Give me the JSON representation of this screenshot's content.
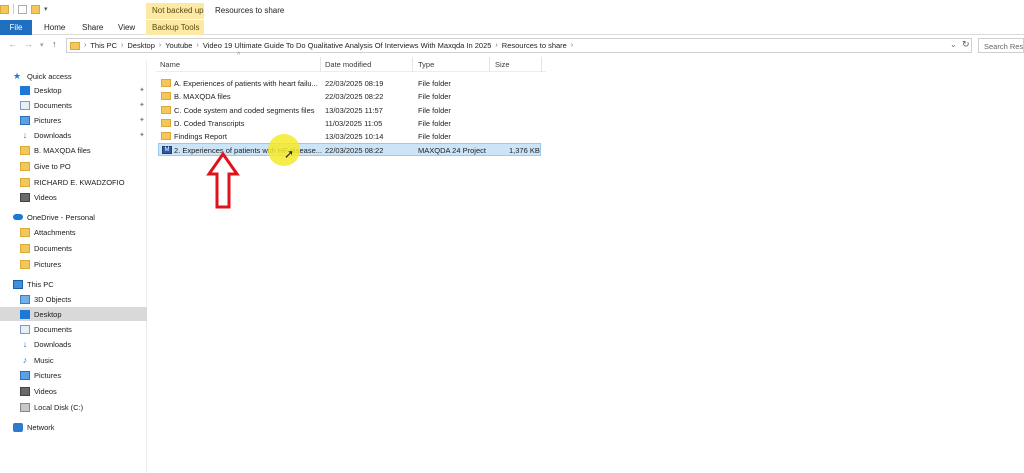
{
  "ribbon": {
    "manage_tab": "Not backed up",
    "window_title": "Resources to share",
    "tabs": {
      "file": "File",
      "home": "Home",
      "share": "Share",
      "view": "View",
      "backup_tools": "Backup Tools"
    }
  },
  "address_bar": {
    "crumbs": [
      "This PC",
      "Desktop",
      "Youtube",
      "Video 19 Ultimate Guide To Do Qualitative Analysis Of Interviews With Maxqda In 2025",
      "Resources to share"
    ]
  },
  "search": {
    "placeholder": "Search Reso"
  },
  "nav": {
    "quick_access": "Quick access",
    "qa_items": [
      "Desktop",
      "Documents",
      "Pictures",
      "Downloads",
      "B. MAXQDA files",
      "Give to PO",
      "RICHARD E. KWADZOFIO",
      "Videos"
    ],
    "onedrive": "OneDrive - Personal",
    "od_items": [
      "Attachments",
      "Documents",
      "Pictures"
    ],
    "this_pc": "This PC",
    "pc_items": [
      "3D Objects",
      "Desktop",
      "Documents",
      "Downloads",
      "Music",
      "Pictures",
      "Videos",
      "Local Disk (C:)"
    ],
    "network": "Network"
  },
  "columns": {
    "name": "Name",
    "date": "Date modified",
    "type": "Type",
    "size": "Size"
  },
  "files": [
    {
      "name": "A. Experiences of patients with heart failu...",
      "date": "22/03/2025 08:19",
      "type": "File folder",
      "size": ""
    },
    {
      "name": "B. MAXQDA files",
      "date": "22/03/2025 08:22",
      "type": "File folder",
      "size": ""
    },
    {
      "name": "C. Code system and coded segments files",
      "date": "13/03/2025 11:57",
      "type": "File folder",
      "size": ""
    },
    {
      "name": "D. Coded Transcripts",
      "date": "11/03/2025 11:05",
      "type": "File folder",
      "size": ""
    },
    {
      "name": "Findings Report",
      "date": "13/03/2025 10:14",
      "type": "File folder",
      "size": ""
    },
    {
      "name": "2. Experiences of patients with HF disease...",
      "date": "22/03/2025 08:22",
      "type": "MAXQDA 24 Project",
      "size": "1,376 KB"
    }
  ]
}
